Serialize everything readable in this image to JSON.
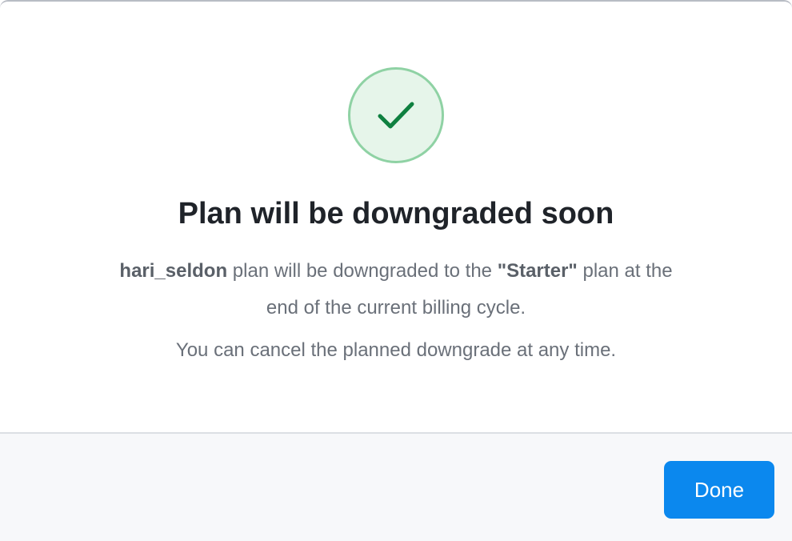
{
  "dialog": {
    "icon": "check-icon",
    "title": "Plan will be downgraded soon",
    "message": {
      "account": "hari_seldon",
      "text_before_plan": " plan will be downgraded to the ",
      "plan": "\"Starter\"",
      "text_after_plan": " plan at the end of the current billing cycle."
    },
    "note": "You can cancel the planned downgrade at any time."
  },
  "footer": {
    "done_label": "Done"
  },
  "colors": {
    "accent": "#0b88ee",
    "success_fill": "#e6f5ea",
    "success_border": "#8fd2a4",
    "success_check": "#0f8040"
  }
}
